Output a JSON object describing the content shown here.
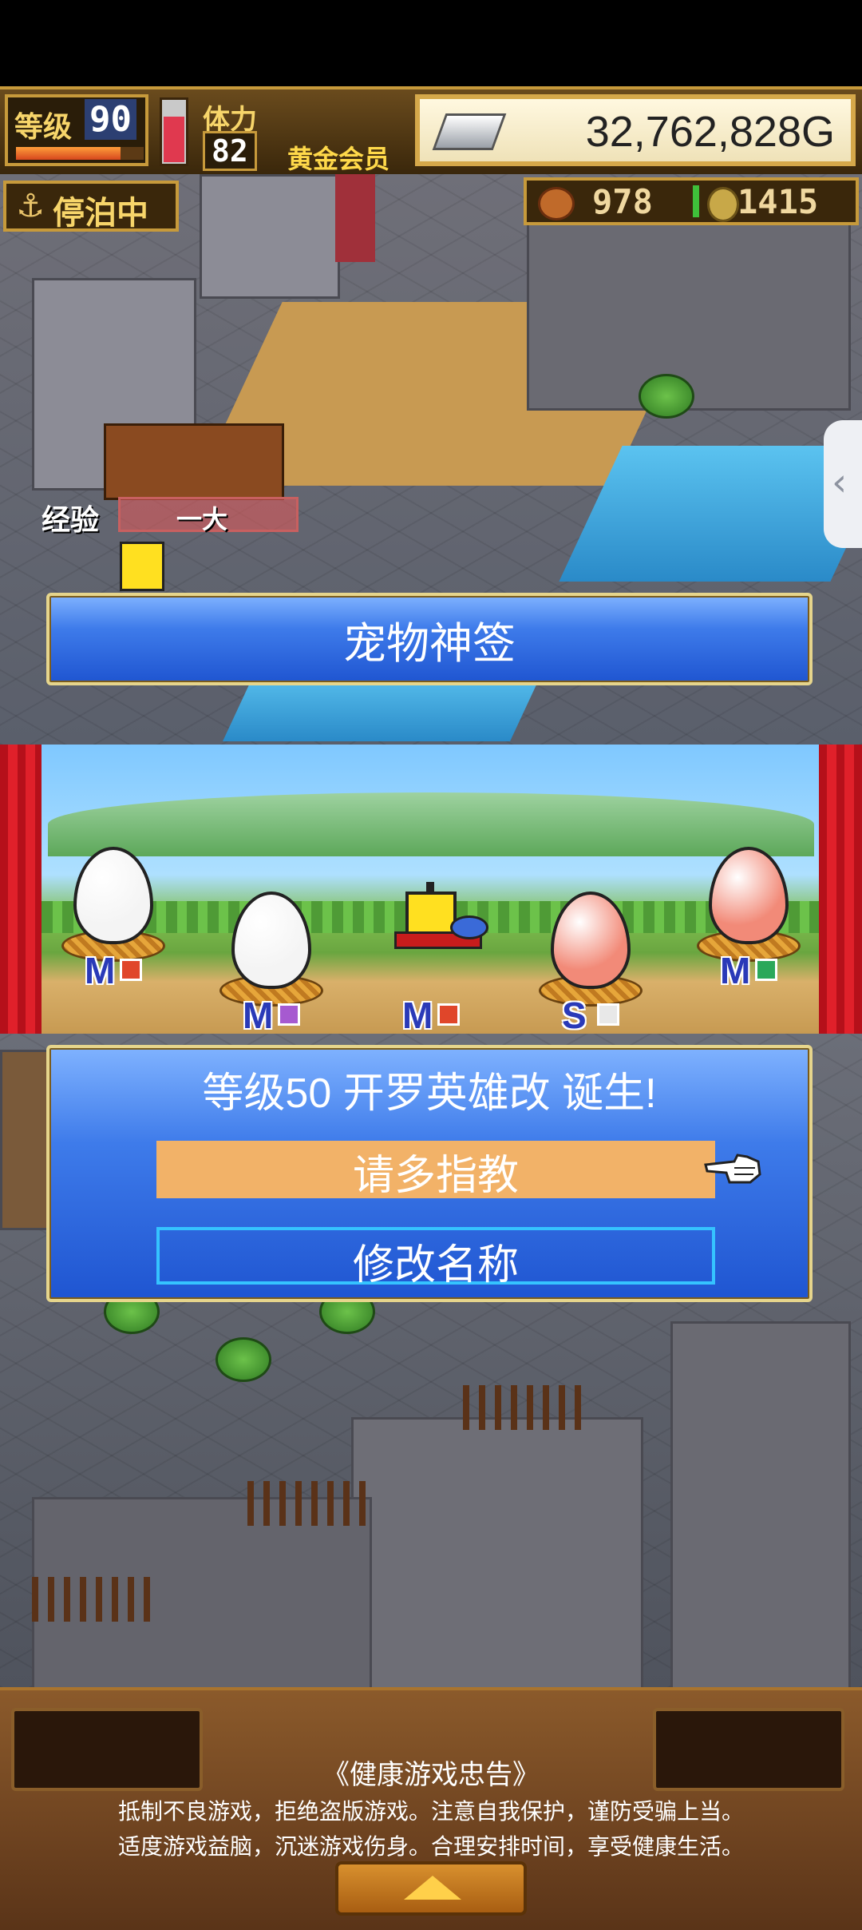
{
  "hud": {
    "level_label": "等级",
    "level_value": "90",
    "level_progress": 0.82,
    "stamina_label": "体力",
    "stamina_value": "82",
    "stamina_fill": 0.75,
    "membership": "黄金会员",
    "gold": "32,762,828G"
  },
  "status": {
    "docked_label": "停泊中"
  },
  "resources": {
    "food": "978",
    "coins": "1415"
  },
  "building": {
    "exp_tag": "经验",
    "exp_bar_text": "一大"
  },
  "title_banner": "宠物神签",
  "stage": {
    "pets": [
      {
        "kind": "egg",
        "color": "#f4f4f4",
        "rank": "M",
        "element_color": "#e0462a",
        "element": "fire-icon"
      },
      {
        "kind": "egg",
        "color": "#f4f4f4",
        "rank": "M",
        "element_color": "#a65ad0",
        "element": "purple-square-icon"
      },
      {
        "kind": "character",
        "rank": "M",
        "element_color": "#e0462a",
        "element": "fire-icon"
      },
      {
        "kind": "egg",
        "color": "#f28a78",
        "rank": "S",
        "element_color": "#e8e8e8",
        "element": "white-orb-icon"
      },
      {
        "kind": "egg",
        "color": "#f28a78",
        "rank": "M",
        "element_color": "#2aa85a",
        "element": "green-square-icon"
      }
    ]
  },
  "dialog": {
    "message": "等级50 开罗英雄改 诞生!",
    "greet_button": "请多指教",
    "rename_button": "修改名称"
  },
  "footer": {
    "notice_title": "《健康游戏忠告》",
    "notice_line1": "抵制不良游戏，拒绝盗版游戏。注意自我保护，谨防受骗上当。",
    "notice_line2": "适度游戏益脑，沉迷游戏伤身。合理安排时间，享受健康生活。"
  },
  "colors": {
    "panel_blue": "#3e7bea",
    "button_orange": "#f2b268",
    "frame_gold": "#c79a3b"
  }
}
